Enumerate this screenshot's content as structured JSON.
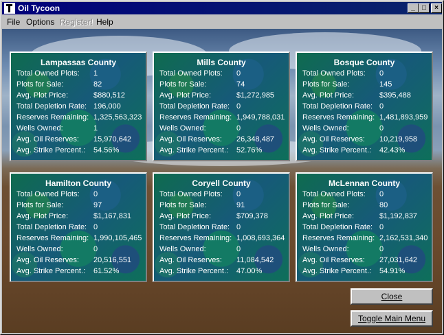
{
  "window": {
    "title": "Oil Tycoon"
  },
  "titlebar_buttons": {
    "minimize": "_",
    "maximize": "□",
    "close": "×"
  },
  "menu": [
    {
      "label": "File",
      "enabled": true
    },
    {
      "label": "Options",
      "enabled": true
    },
    {
      "label": "Register!",
      "enabled": false
    },
    {
      "label": "Help",
      "enabled": true
    }
  ],
  "labels": {
    "owned": "Total Owned Plots:",
    "for_sale": "Plots for Sale:",
    "price": "Avg. Plot Price:",
    "depletion": "Total Depletion Rate:",
    "reserves": "Reserves Remaining:",
    "wells": "Wells Owned:",
    "oil": "Avg. Oil Reserves:",
    "strike": "Avg. Strike Percent.:"
  },
  "counties": [
    {
      "name": "Lampassas County",
      "owned": "1",
      "for_sale": "82",
      "price": "$880,512",
      "depletion": "196,000",
      "reserves": "1,325,563,323",
      "wells": "1",
      "oil": "15,970,642",
      "strike": "54.56%"
    },
    {
      "name": "Mills County",
      "owned": "0",
      "for_sale": "74",
      "price": "$1,272,985",
      "depletion": "0",
      "reserves": "1,949,788,031",
      "wells": "0",
      "oil": "26,348,487",
      "strike": "52.76%"
    },
    {
      "name": "Bosque County",
      "owned": "0",
      "for_sale": "145",
      "price": "$395,488",
      "depletion": "0",
      "reserves": "1,481,893,959",
      "wells": "0",
      "oil": "10,219,958",
      "strike": "42.43%"
    },
    {
      "name": "Hamilton County",
      "owned": "0",
      "for_sale": "97",
      "price": "$1,167,831",
      "depletion": "0",
      "reserves": "1,990,105,465",
      "wells": "0",
      "oil": "20,516,551",
      "strike": "61.52%"
    },
    {
      "name": "Coryell County",
      "owned": "0",
      "for_sale": "91",
      "price": "$709,378",
      "depletion": "0",
      "reserves": "1,008,693,364",
      "wells": "0",
      "oil": "11,084,542",
      "strike": "47.00%"
    },
    {
      "name": "McLennan County",
      "owned": "0",
      "for_sale": "80",
      "price": "$1,192,837",
      "depletion": "0",
      "reserves": "2,162,531,340",
      "wells": "0",
      "oil": "27,031,642",
      "strike": "54.91%"
    }
  ],
  "buttons": {
    "close": "Close",
    "toggle": "Toggle Main Menu"
  }
}
